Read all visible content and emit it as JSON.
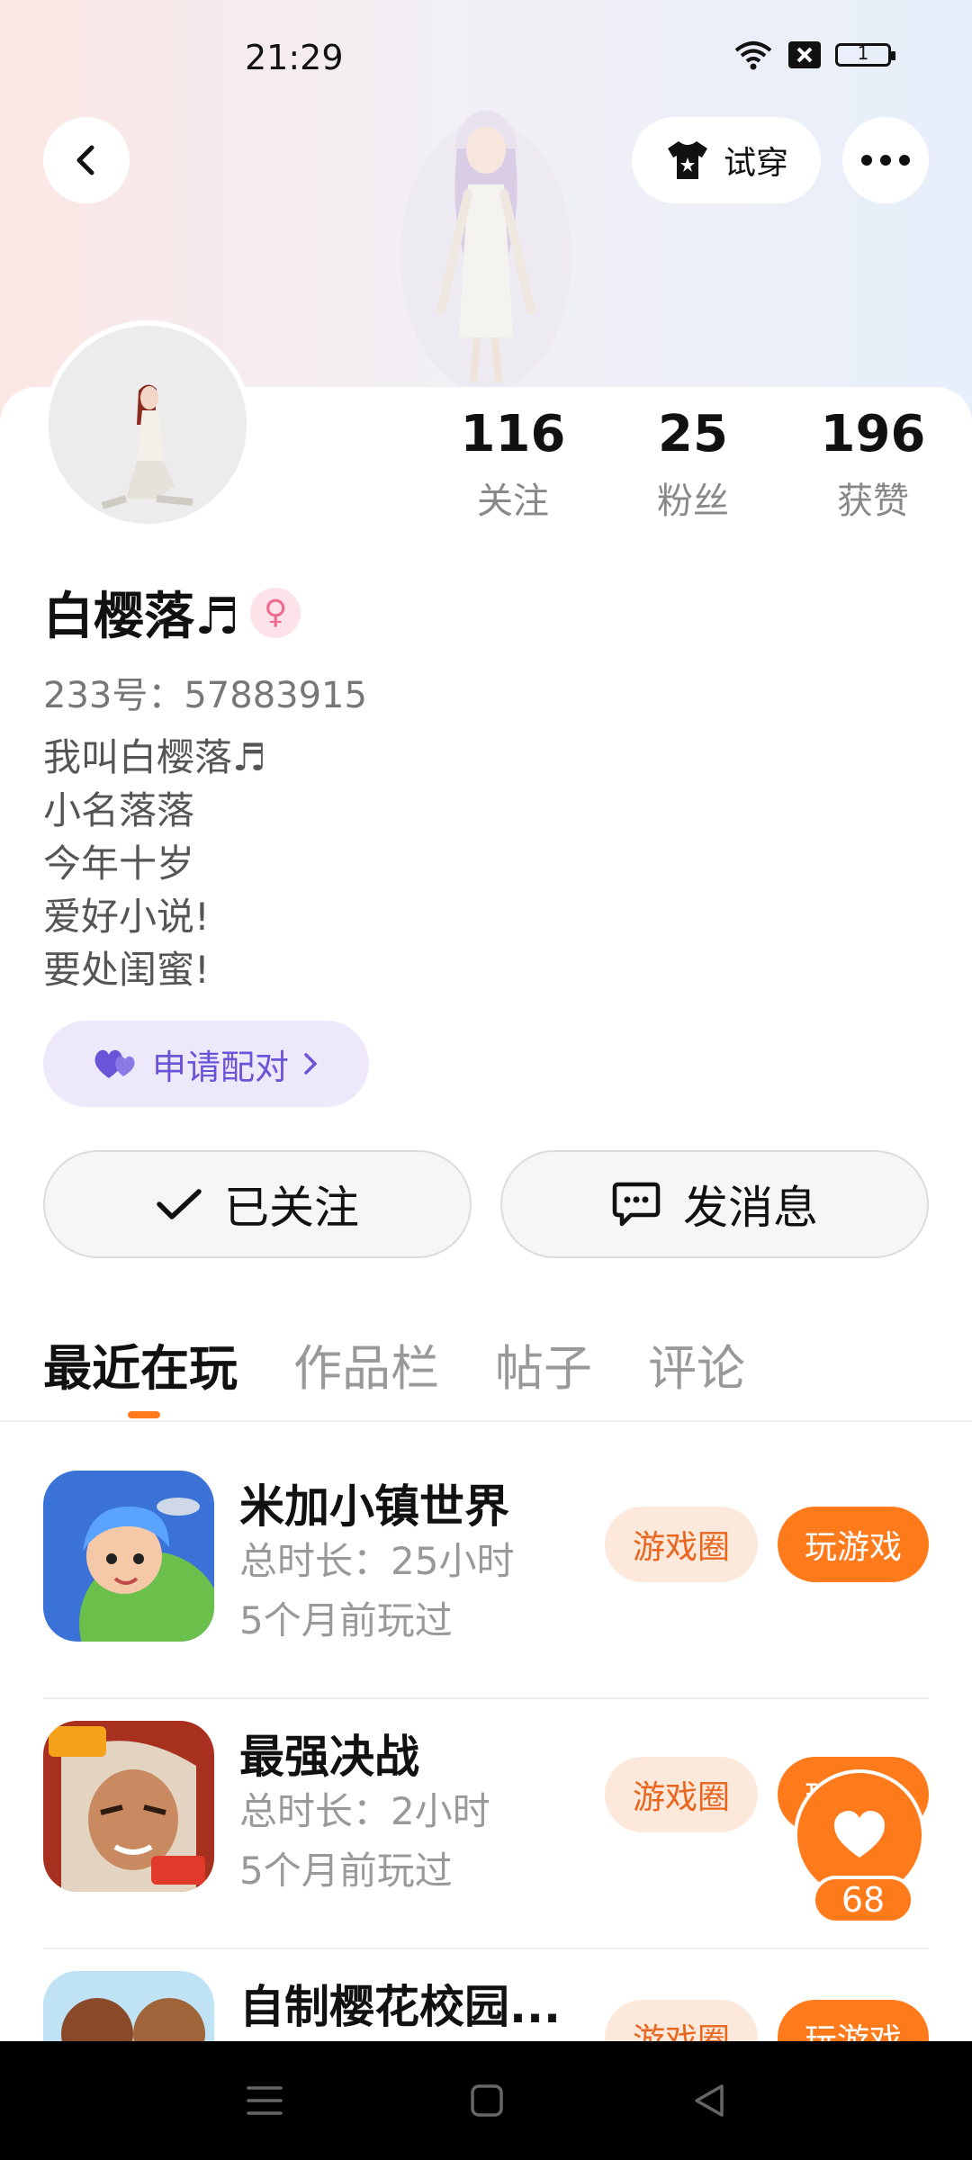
{
  "status_bar": {
    "time": "21:29",
    "battery": "1"
  },
  "header": {
    "tryon_label": "试穿"
  },
  "stats": [
    {
      "value": "116",
      "label": "关注"
    },
    {
      "value": "25",
      "label": "粉丝"
    },
    {
      "value": "196",
      "label": "获赞"
    }
  ],
  "profile": {
    "name": "白樱落♬",
    "uid": "233号：57883915",
    "bio": [
      "我叫白樱落♬",
      "小名落落",
      "今年十岁",
      "爱好小说!",
      "要处闺蜜!"
    ],
    "pair_label": "申请配对"
  },
  "actions": {
    "followed_label": "已关注",
    "message_label": "发消息"
  },
  "tabs": [
    "最近在玩",
    "作品栏",
    "帖子",
    "评论"
  ],
  "games": [
    {
      "name": "米加小镇世界",
      "duration": "总时长：25小时",
      "last_played": "5个月前玩过",
      "circle_label": "游戏圈",
      "play_label": "玩游戏"
    },
    {
      "name": "最强决战",
      "duration": "总时长：2小时",
      "last_played": "5个月前玩过",
      "circle_label": "游戏圈",
      "play_label": "玩游戏"
    },
    {
      "name": "自制樱花校园...",
      "duration": "",
      "last_played": "",
      "circle_label": "游戏圈",
      "play_label": "玩游戏"
    }
  ],
  "like_count": "68",
  "colors": {
    "accent": "#ff7a1a",
    "pair_purple": "#6a55d8"
  },
  "icons": [
    "back-arrow-icon",
    "tshirt-icon",
    "more-dots-icon",
    "heart-icon",
    "checkmark-icon",
    "chat-icon",
    "wifi-icon",
    "battery-icon"
  ]
}
